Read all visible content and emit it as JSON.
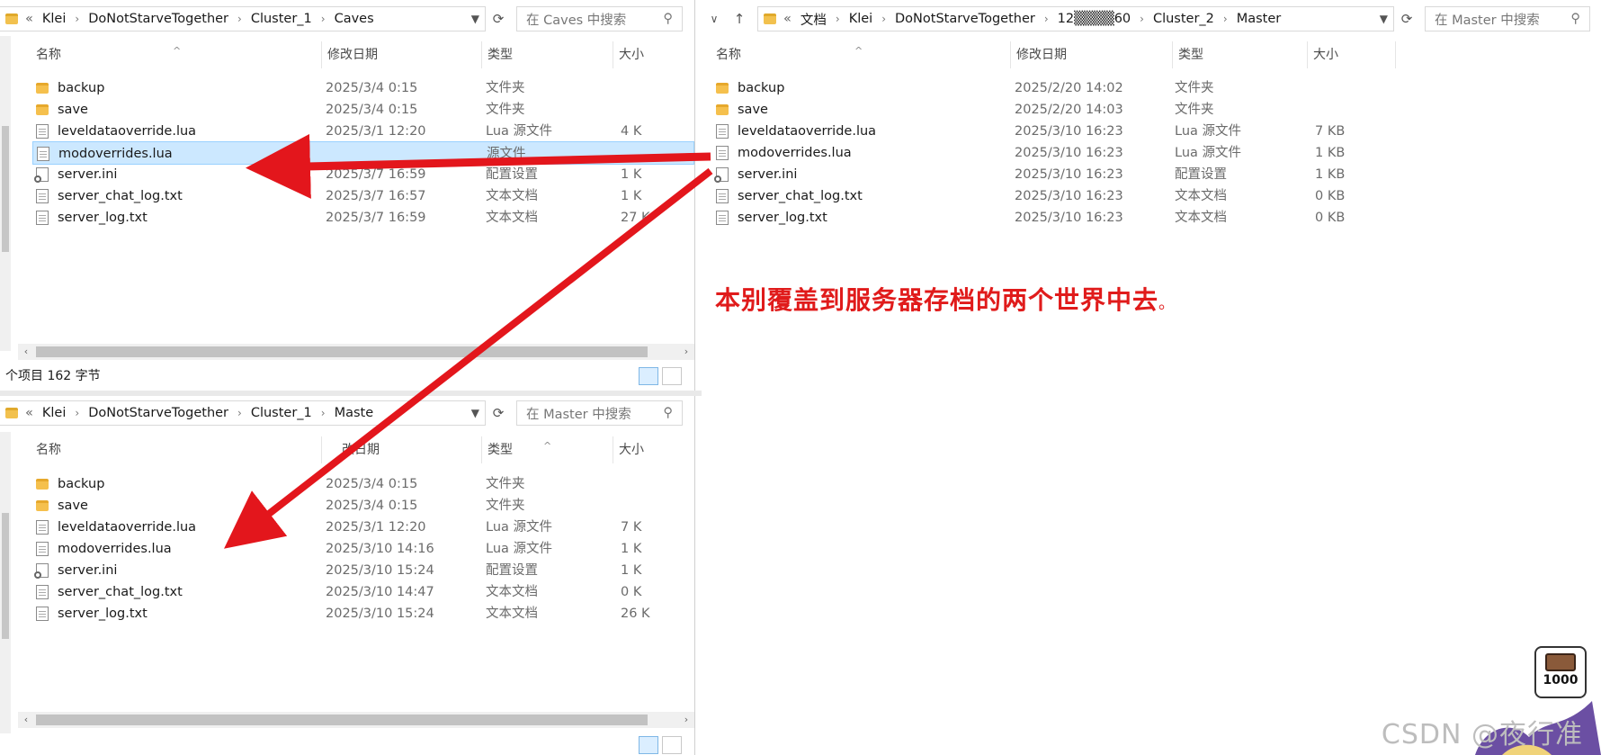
{
  "left_top": {
    "breadcrumb": [
      "Klei",
      "DoNotStarveTogether",
      "Cluster_1",
      "Caves"
    ],
    "search_placeholder": "在 Caves 中搜索",
    "headers": {
      "name": "名称",
      "date": "修改日期",
      "type": "类型",
      "size": "大小"
    },
    "files": [
      {
        "name": "backup",
        "date": "2025/3/4 0:15",
        "type": "文件夹",
        "size": "",
        "icon": "folder-icon"
      },
      {
        "name": "save",
        "date": "2025/3/4 0:15",
        "type": "文件夹",
        "size": "",
        "icon": "folder-icon"
      },
      {
        "name": "leveldataoverride.lua",
        "date": "2025/3/1 12:20",
        "type": "Lua 源文件",
        "size": "4 K",
        "icon": "file-icon"
      },
      {
        "name": "modoverrides.lua",
        "date": "",
        "type": "源文件",
        "size": "",
        "icon": "file-icon",
        "selected": true
      },
      {
        "name": "server.ini",
        "date": "2025/3/7 16:59",
        "type": "配置设置",
        "size": "1 K",
        "icon": "settings-file-icon"
      },
      {
        "name": "server_chat_log.txt",
        "date": "2025/3/7 16:57",
        "type": "文本文档",
        "size": "1 K",
        "icon": "file-icon"
      },
      {
        "name": "server_log.txt",
        "date": "2025/3/7 16:59",
        "type": "文本文档",
        "size": "27 K",
        "icon": "file-icon"
      }
    ],
    "status": "个项目  162 字节"
  },
  "left_bottom": {
    "breadcrumb": [
      "Klei",
      "DoNotStarveTogether",
      "Cluster_1",
      "Maste"
    ],
    "search_placeholder": "在 Master 中搜索",
    "headers": {
      "name": "名称",
      "date": "改日期",
      "type": "类型",
      "size": "大小"
    },
    "files": [
      {
        "name": "backup",
        "date": "2025/3/4 0:15",
        "type": "文件夹",
        "size": "",
        "icon": "folder-icon"
      },
      {
        "name": "save",
        "date": "2025/3/4 0:15",
        "type": "文件夹",
        "size": "",
        "icon": "folder-icon"
      },
      {
        "name": "leveldataoverride.lua",
        "date": "2025/3/1 12:20",
        "type": "Lua 源文件",
        "size": "7 K",
        "icon": "file-icon"
      },
      {
        "name": "modoverrides.lua",
        "date": "2025/3/10 14:16",
        "type": "Lua 源文件",
        "size": "1 K",
        "icon": "file-icon"
      },
      {
        "name": "server.ini",
        "date": "2025/3/10 15:24",
        "type": "配置设置",
        "size": "1 K",
        "icon": "settings-file-icon"
      },
      {
        "name": "server_chat_log.txt",
        "date": "2025/3/10 14:47",
        "type": "文本文档",
        "size": "0 K",
        "icon": "file-icon"
      },
      {
        "name": "server_log.txt",
        "date": "2025/3/10 15:24",
        "type": "文本文档",
        "size": "26 K",
        "icon": "file-icon"
      }
    ]
  },
  "right": {
    "breadcrumb": [
      "文档",
      "Klei",
      "DoNotStarveTogether",
      "12▒▒▒▒60",
      "Cluster_2",
      "Master"
    ],
    "search_placeholder": "在 Master 中搜索",
    "headers": {
      "name": "名称",
      "date": "修改日期",
      "type": "类型",
      "size": "大小"
    },
    "files": [
      {
        "name": "backup",
        "date": "2025/2/20 14:02",
        "type": "文件夹",
        "size": "",
        "icon": "folder-icon"
      },
      {
        "name": "save",
        "date": "2025/2/20 14:03",
        "type": "文件夹",
        "size": "",
        "icon": "folder-icon"
      },
      {
        "name": "leveldataoverride.lua",
        "date": "2025/3/10 16:23",
        "type": "Lua 源文件",
        "size": "7 KB",
        "icon": "file-icon"
      },
      {
        "name": "modoverrides.lua",
        "date": "2025/3/10 16:23",
        "type": "Lua 源文件",
        "size": "1 KB",
        "icon": "file-icon"
      },
      {
        "name": "server.ini",
        "date": "2025/3/10 16:23",
        "type": "配置设置",
        "size": "1 KB",
        "icon": "settings-file-icon"
      },
      {
        "name": "server_chat_log.txt",
        "date": "2025/3/10 16:23",
        "type": "文本文档",
        "size": "0 KB",
        "icon": "file-icon"
      },
      {
        "name": "server_log.txt",
        "date": "2025/3/10 16:23",
        "type": "文本文档",
        "size": "0 KB",
        "icon": "file-icon"
      }
    ]
  },
  "annotation": {
    "text": "本别覆盖到服务器存档的两个世界中去",
    "tail": "。",
    "color": "#e01b1b"
  },
  "watermark": "CSDN @夜行准",
  "badge_number": "1000",
  "colors": {
    "selection": "#cce8ff",
    "arrow": "#e3161c",
    "folder": "#f5c04d"
  }
}
